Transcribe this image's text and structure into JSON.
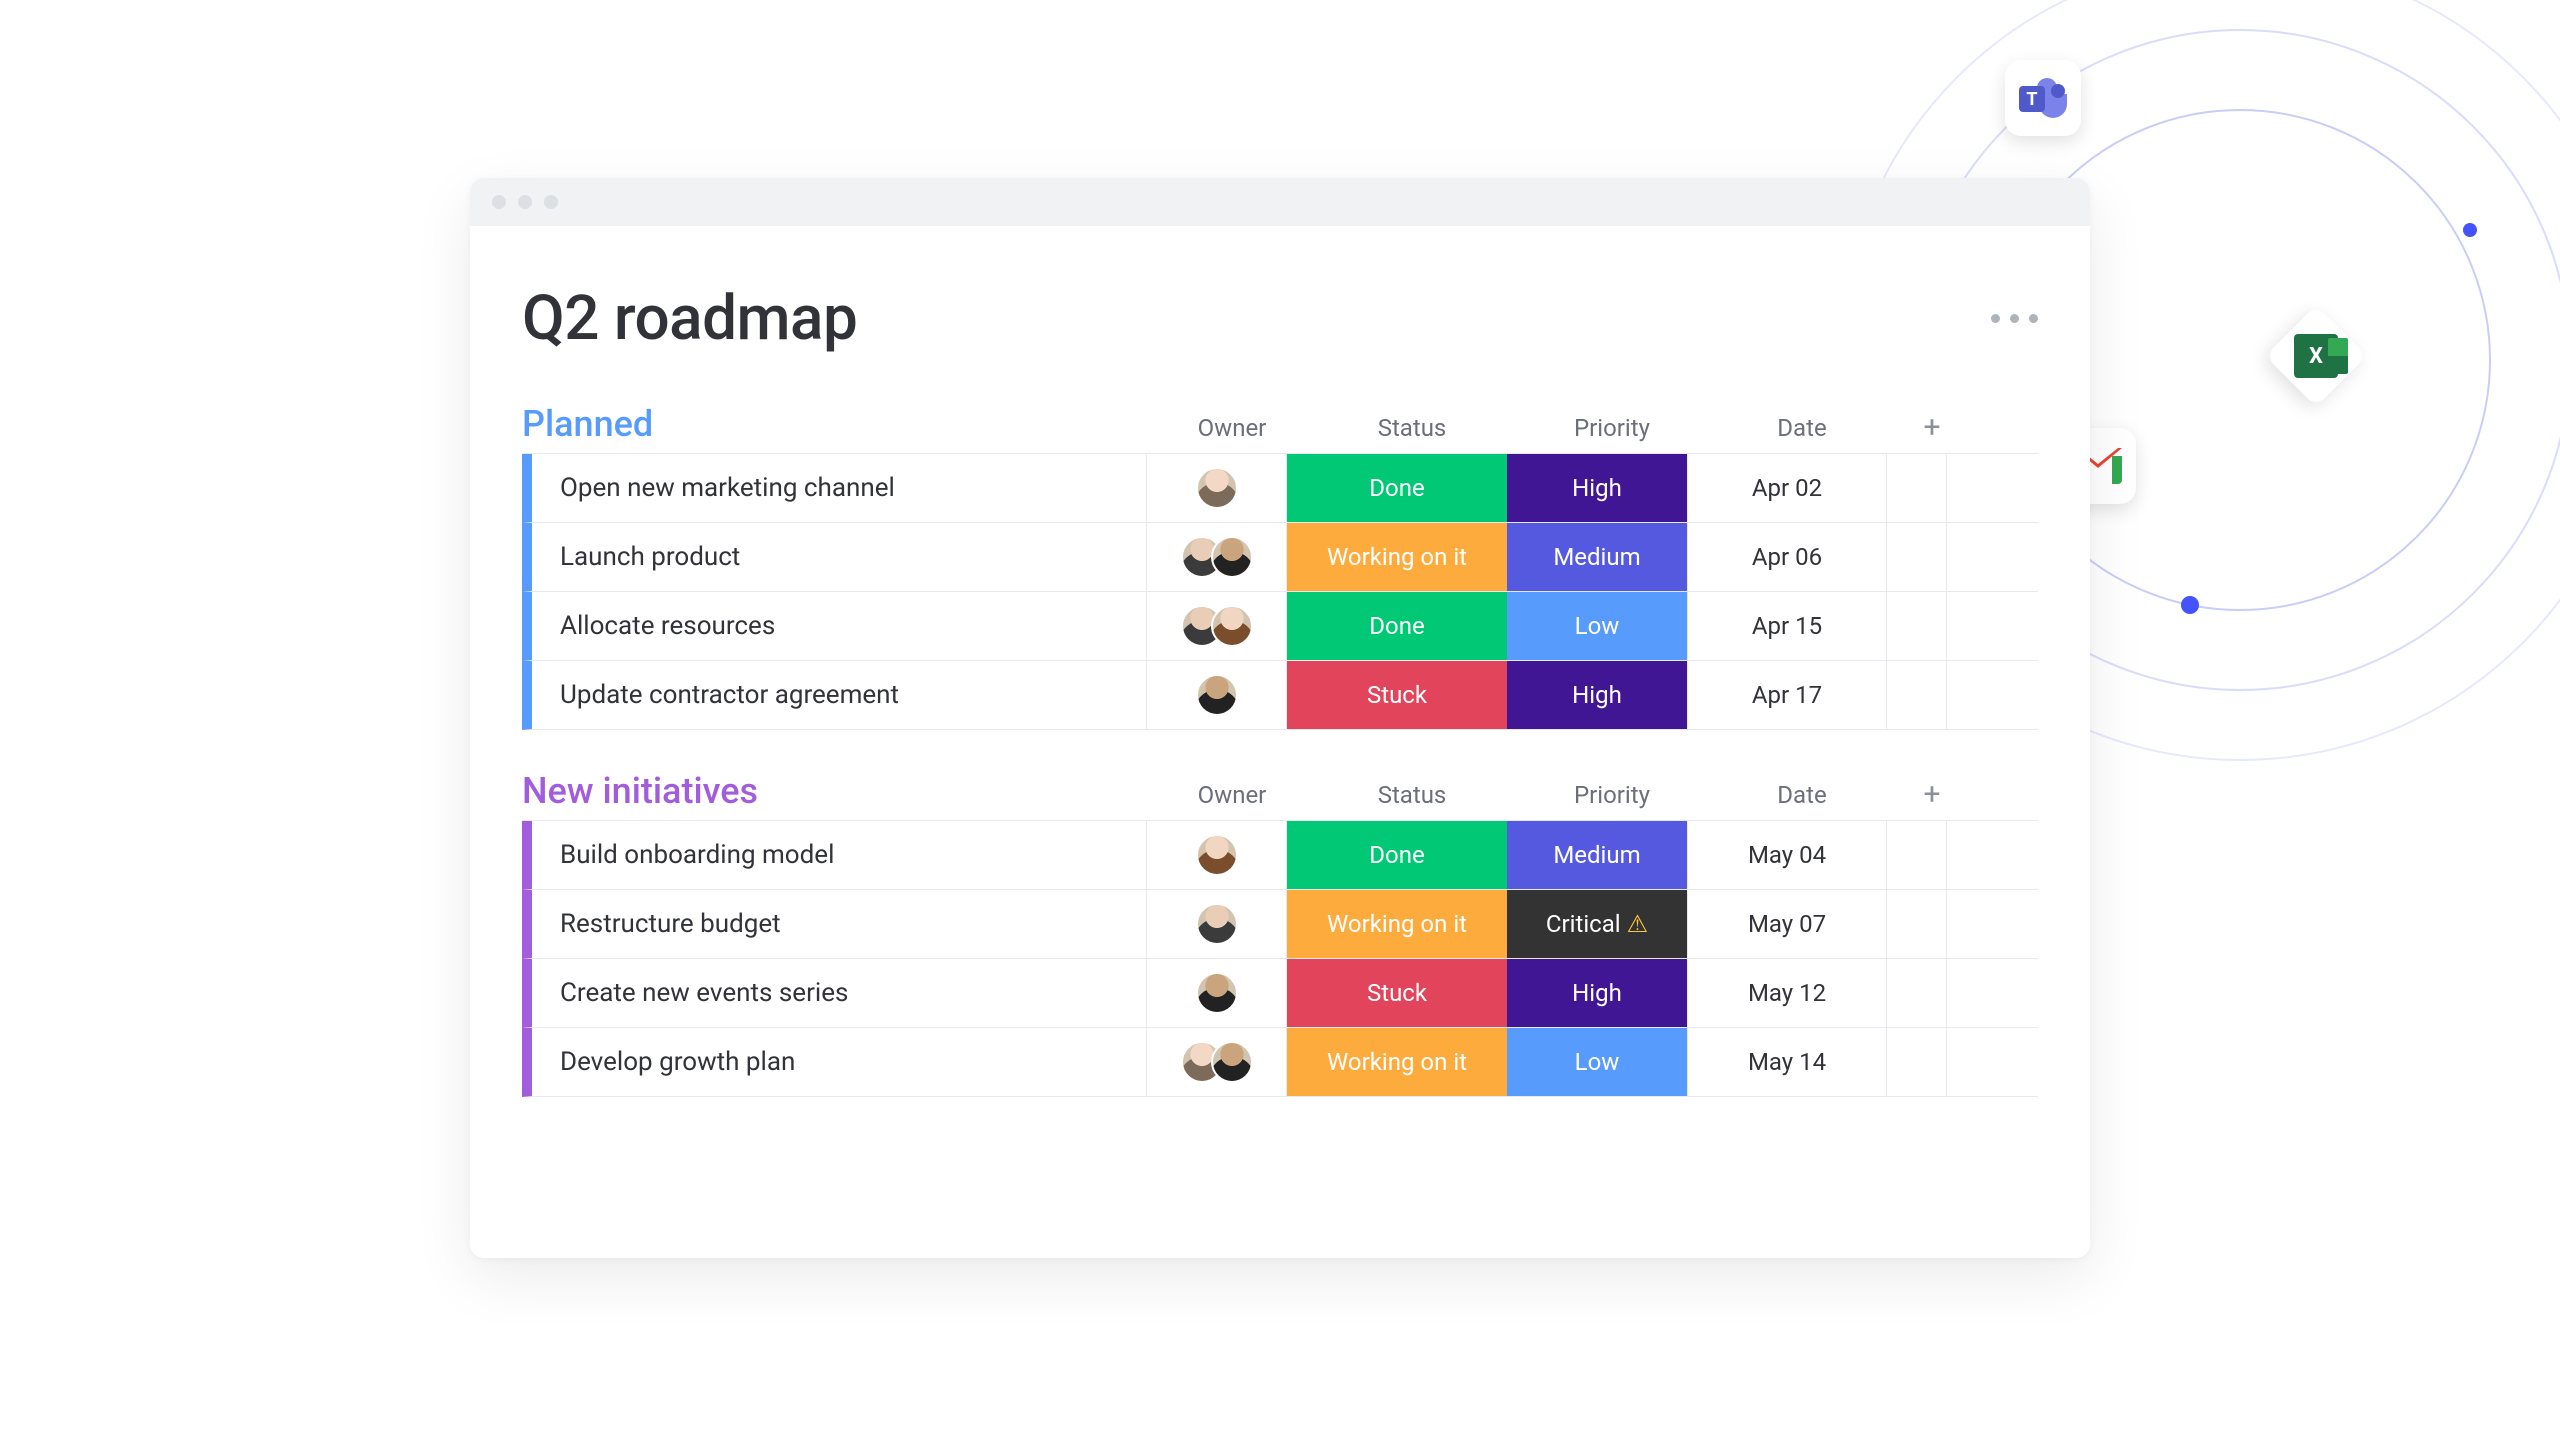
{
  "board": {
    "title": "Q2 roadmap",
    "columns": {
      "owner": "Owner",
      "status": "Status",
      "priority": "Priority",
      "date": "Date",
      "add": "+"
    },
    "groups": [
      {
        "name": "Planned",
        "color": "#579bfc",
        "rows": [
          {
            "task": "Open new marketing channel",
            "owners": [
              "a1"
            ],
            "status": {
              "label": "Done",
              "color": "#00c875"
            },
            "priority": {
              "label": "High",
              "color": "#401694"
            },
            "date": "Apr 02"
          },
          {
            "task": "Launch product",
            "owners": [
              "a2",
              "a3"
            ],
            "status": {
              "label": "Working on it",
              "color": "#fdab3d"
            },
            "priority": {
              "label": "Medium",
              "color": "#5559df"
            },
            "date": "Apr 06"
          },
          {
            "task": "Allocate resources",
            "owners": [
              "a2",
              "a4"
            ],
            "status": {
              "label": "Done",
              "color": "#00c875"
            },
            "priority": {
              "label": "Low",
              "color": "#579bfc"
            },
            "date": "Apr 15"
          },
          {
            "task": "Update contractor agreement",
            "owners": [
              "a5"
            ],
            "status": {
              "label": "Stuck",
              "color": "#e2445c"
            },
            "priority": {
              "label": "High",
              "color": "#401694"
            },
            "date": "Apr 17"
          }
        ]
      },
      {
        "name": "New initiatives",
        "color": "#a25ddc",
        "rows": [
          {
            "task": "Build onboarding model",
            "owners": [
              "a4"
            ],
            "status": {
              "label": "Done",
              "color": "#00c875"
            },
            "priority": {
              "label": "Medium",
              "color": "#5559df"
            },
            "date": "May 04"
          },
          {
            "task": "Restructure budget",
            "owners": [
              "a6"
            ],
            "status": {
              "label": "Working on it",
              "color": "#fdab3d"
            },
            "priority": {
              "label": "Critical",
              "color": "#333333",
              "warn": true
            },
            "date": "May 07"
          },
          {
            "task": "Create new events series",
            "owners": [
              "a5"
            ],
            "status": {
              "label": "Stuck",
              "color": "#e2445c"
            },
            "priority": {
              "label": "High",
              "color": "#401694"
            },
            "date": "May 12"
          },
          {
            "task": "Develop growth plan",
            "owners": [
              "a1",
              "a7"
            ],
            "status": {
              "label": "Working on it",
              "color": "#fdab3d"
            },
            "priority": {
              "label": "Low",
              "color": "#579bfc"
            },
            "date": "May 14"
          }
        ]
      }
    ]
  },
  "integrations": [
    "teams",
    "excel",
    "gmail"
  ]
}
